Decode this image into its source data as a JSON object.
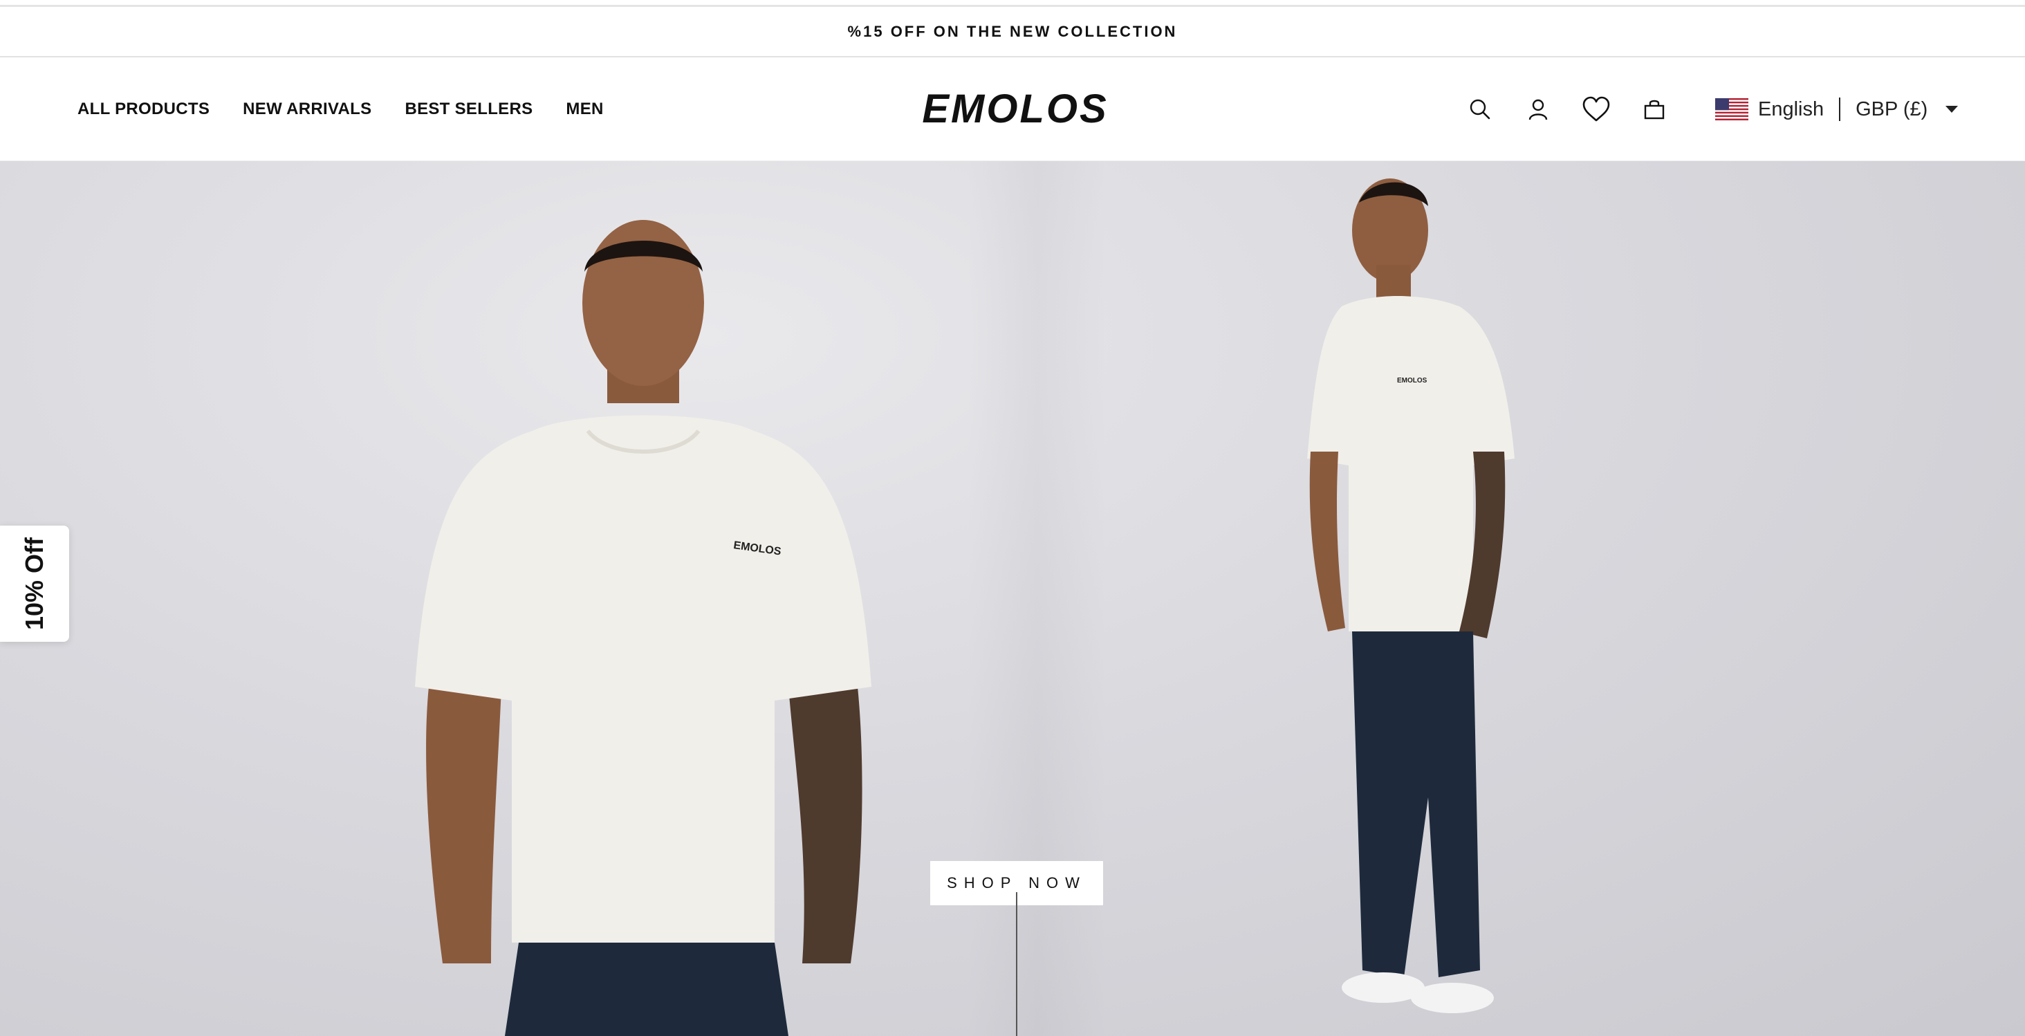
{
  "announcement": {
    "text": "%15 OFF ON THE NEW COLLECTION"
  },
  "header": {
    "nav": [
      {
        "label": "ALL PRODUCTS"
      },
      {
        "label": "NEW ARRIVALS"
      },
      {
        "label": "BEST SELLERS"
      },
      {
        "label": "MEN"
      }
    ],
    "logo_text": "EMOLOS",
    "icons": [
      "search-icon",
      "account-icon",
      "wishlist-heart-icon",
      "cart-bag-icon"
    ],
    "locale": {
      "flag": "us-flag-icon",
      "language": "English",
      "currency": "GBP (£)"
    }
  },
  "hero": {
    "cta_label": "SHOP NOW",
    "shirt_logo": "EMOLOS"
  },
  "discount_tab": {
    "label": "10% Off"
  },
  "colors": {
    "background": "#ffffff",
    "text": "#111111",
    "hero_bg": "#d9d9de",
    "shirt": "#f1efea",
    "denim": "#1e2a3c"
  }
}
